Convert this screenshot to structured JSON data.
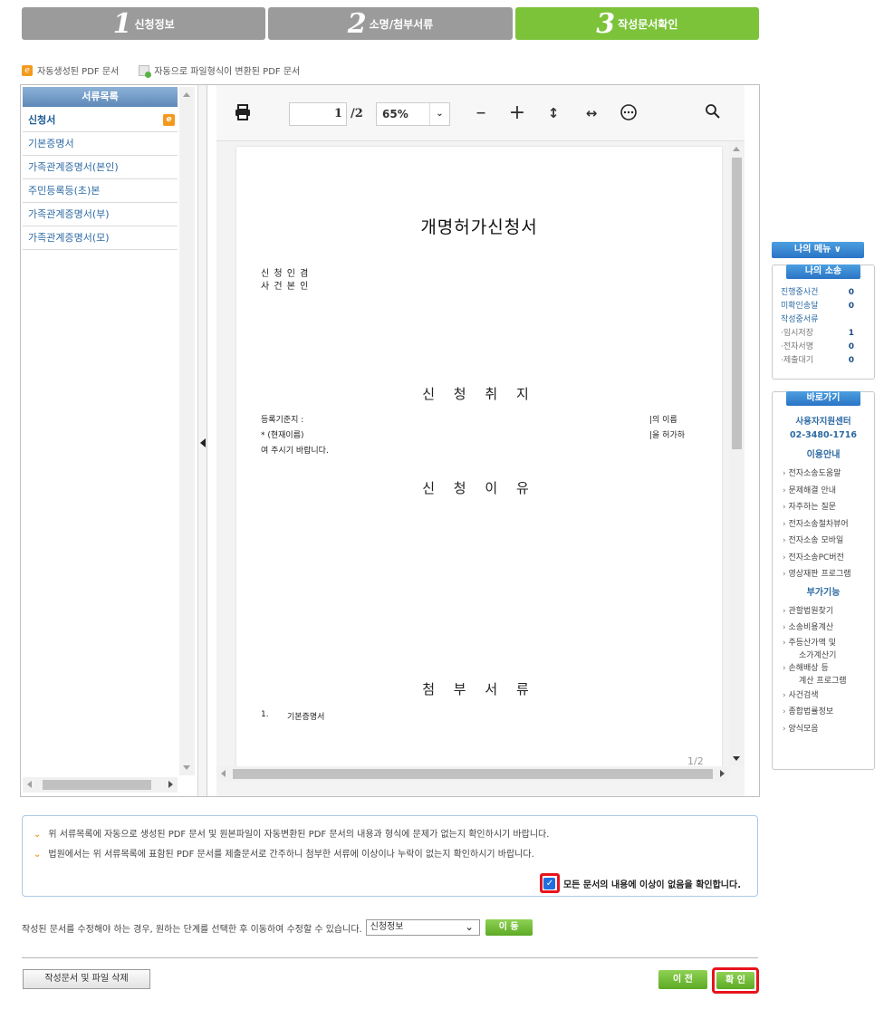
{
  "steps": [
    {
      "num": "1",
      "label": "신청정보"
    },
    {
      "num": "2",
      "label": "소명/첨부서류"
    },
    {
      "num": "3",
      "label": "작성문서확인"
    }
  ],
  "legend": {
    "auto": "자동생성된 PDF 문서",
    "converted": "자동으로 파일형식이 변환된 PDF 문서"
  },
  "doclist": {
    "header": "서류목록",
    "items": [
      {
        "label": "신청서"
      },
      {
        "label": "기본증명서"
      },
      {
        "label": "가족관계증명서(본인)"
      },
      {
        "label": "주민등록등(초)본"
      },
      {
        "label": "가족관계증명서(부)"
      },
      {
        "label": "가족관계증명서(모)"
      }
    ]
  },
  "viewer": {
    "page_current": "1",
    "page_total": "/2",
    "zoom": "65%",
    "page_indicator": "1/2"
  },
  "document": {
    "title": "개명허가신청서",
    "meta_line1": "신 청 인 겸",
    "meta_line2": "사 건 본 인",
    "section_purpose": "신 청 취 지",
    "purpose_l1_left": "등록기준지 :",
    "purpose_l1_right": "|의 이름",
    "purpose_l2_left": "* (현재이름)",
    "purpose_l2_right": "|을 허가하",
    "purpose_l3": "여 주시기 바랍니다.",
    "section_reason": "신 청 이 유",
    "section_attach": "첨 부 서 류",
    "attach_1_num": "1.",
    "attach_1": "기본증명서"
  },
  "notice": {
    "line1": "위 서류목록에 자동으로 생성된 PDF 문서 및 원본파일이 자동변환된 PDF 문서의 내용과 형식에 문제가 없는지 확인하시기 바랍니다.",
    "line2": "법원에서는 위 서류목록에 표함된 PDF 문서를 제출문서로 간주하니 첨부한 서류에 이상이나 누락이 없는지 확인하시기 바랍니다.",
    "confirm": "모든 문서의 내용에 이상이 없음을 확인합니다."
  },
  "modify": {
    "text": "작성된 문서를 수정해야 하는 경우, 원하는 단계를 선택한 후 이동하여 수정할 수 있습니다.",
    "select": "신청정보",
    "move": "이 동"
  },
  "actions": {
    "delete": "작성문서 및 파일 삭제",
    "prev": "이 전",
    "confirm": "확 인"
  },
  "right_panel": {
    "my_menu": "나의 메뉴 ∨",
    "my_case_head": "나의 소송",
    "stats": [
      {
        "k": "진행중사건",
        "v": "0",
        "sub": false
      },
      {
        "k": "미확인송달",
        "v": "0",
        "sub": false
      }
    ],
    "writing_head": "작성중서류",
    "writing": [
      {
        "k": "·임시저장",
        "v": "1"
      },
      {
        "k": "·전자서명",
        "v": "0"
      },
      {
        "k": "·제출대기",
        "v": "0"
      }
    ],
    "shortcut_head": "바로가기",
    "support_center": "사용자지원센터",
    "phone": "02-3480-1716",
    "guide_head": "이용안내",
    "guide": [
      {
        "t": "전자소송도움말",
        "cont": false
      },
      {
        "t": "문제해결 안내",
        "cont": false
      },
      {
        "t": "자주하는 질문",
        "cont": false
      },
      {
        "t": "전자소송절차뷰어",
        "cont": false
      },
      {
        "t": "전자소송 모바일",
        "cont": false
      },
      {
        "t": "전자소송PC버전",
        "cont": false
      },
      {
        "t": "영상재판 프로그램",
        "cont": false
      }
    ],
    "extra_head": "부가기능",
    "extra": [
      {
        "t": "관할법원찾기",
        "cont": false
      },
      {
        "t": "소송비용계산",
        "cont": false
      },
      {
        "t": "주등산가액 및",
        "cont": false
      },
      {
        "t": "소가계산기",
        "cont": true
      },
      {
        "t": "손해배상 등",
        "cont": false
      },
      {
        "t": "계산 프로그램",
        "cont": true
      },
      {
        "t": "사건검색",
        "cont": false
      },
      {
        "t": "종합법률정보",
        "cont": false
      },
      {
        "t": "양식모음",
        "cont": false
      }
    ]
  }
}
